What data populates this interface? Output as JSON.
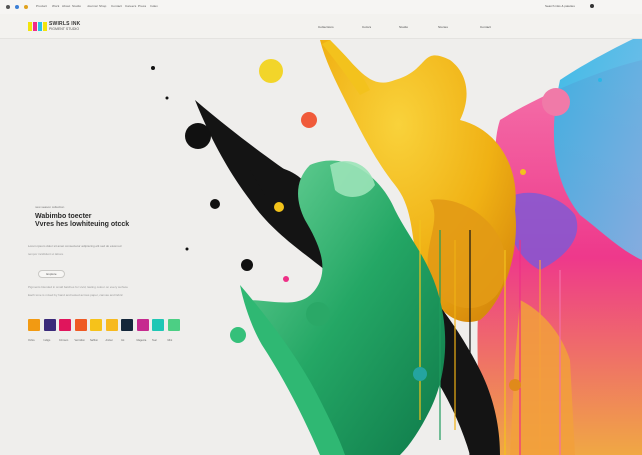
{
  "topbar": {
    "links": [
      "Product",
      "Work",
      "About",
      "Studio",
      "Journal",
      "Shop",
      "Contact",
      "Careers",
      "Press",
      "Index"
    ],
    "search": "Search inks & palettes"
  },
  "header": {
    "logo_title": "SWIRLS INK",
    "logo_sub": "PIGMENT STUDIO",
    "logo_colors": [
      "#f2e40c",
      "#ef2b8a",
      "#2cc1e8",
      "#f2e40c"
    ],
    "nav": [
      "Collections",
      "Colors",
      "Studio",
      "Stories",
      "Contact"
    ]
  },
  "hero": {
    "kicker": "new season collection",
    "headline_line1": "Wabimbo toecter",
    "headline_line2": "Vvres hes lowhiteuing otcck",
    "subline": "Lorem ipsum dolor sit amet consectetur adipiscing elit sed do eiusmod",
    "subline2": "tempor incididunt ut labore",
    "button": "Explore",
    "desc_lines": [
      "Pigments blended in small batches for vivid, lasting colour on every surface",
      "Each tone is mixed by hand and tested across paper, canvas and fabric"
    ]
  },
  "palette": {
    "swatches": [
      {
        "color": "#f29a12",
        "label": "Ochre"
      },
      {
        "color": "#3a2a7a",
        "label": "Indigo"
      },
      {
        "color": "#e0155c",
        "label": "Crimson"
      },
      {
        "color": "#ef5a24",
        "label": "Vermilion"
      },
      {
        "color": "#f6c21a",
        "label": "Saffron"
      },
      {
        "color": "#f7b91f",
        "label": "Amber"
      },
      {
        "color": "#14273a",
        "label": "Ink"
      },
      {
        "color": "#c62a8f",
        "label": "Magenta"
      },
      {
        "color": "#1fc7b5",
        "label": "Teal"
      },
      {
        "color": "#4ccf84",
        "label": "Mint"
      }
    ]
  }
}
